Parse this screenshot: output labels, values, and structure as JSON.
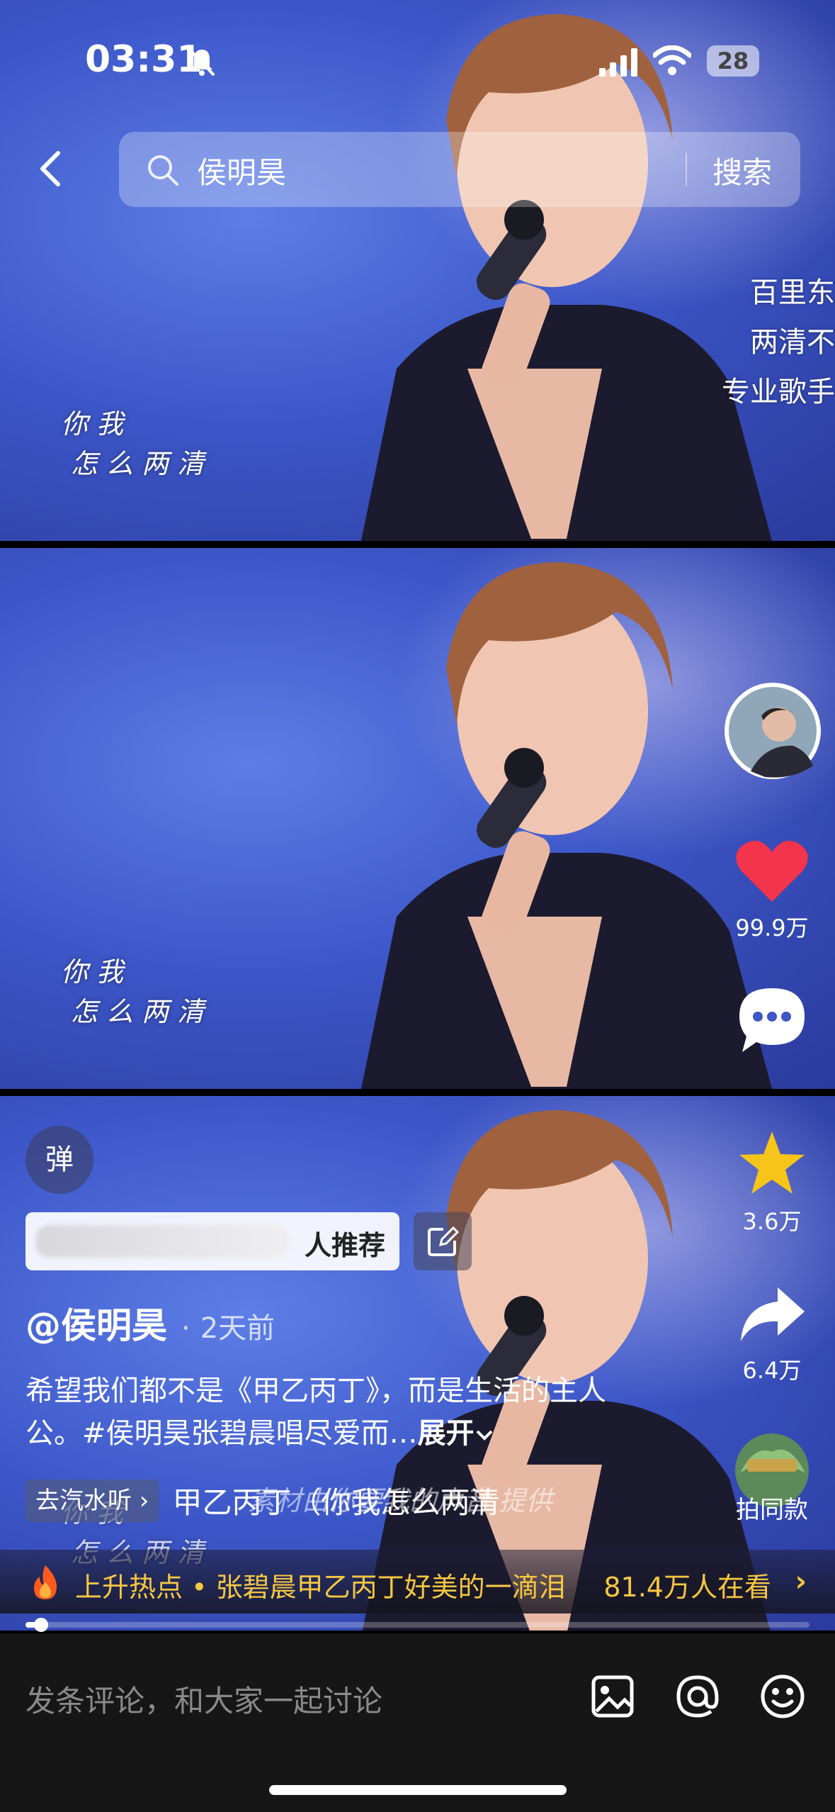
{
  "status_bar": {
    "time": "03:31",
    "battery": "28"
  },
  "search": {
    "query": "侯明昊",
    "button_label": "搜索"
  },
  "overlay_captions": [
    "百里东",
    "两清不",
    "专业歌手"
  ],
  "lyrics": {
    "line1": "你 我",
    "line2": "怎 么 两 清"
  },
  "rail": {
    "likes": "99.9万",
    "favorites": "3.6万",
    "shares": "6.4万",
    "same_style_label": "拍同款"
  },
  "danmu_label": "弹",
  "recommend_label": "人推荐",
  "author": {
    "name": "@侯明昊",
    "time_ago": "2天前"
  },
  "description": {
    "text": "希望我们都不是《甲乙丙丁》，而是生活的主人公。#侯明昊张碧晨唱尽爱而…",
    "expand_label": "展开"
  },
  "music": {
    "tag_label": "去汽水听",
    "title": "甲乙丙丁（你我怎么两清"
  },
  "watermark": "素材由你要我的声音 提供",
  "hot": {
    "text": "上升热点 • 张碧晨甲乙丙丁好美的一滴泪",
    "viewers": "81.4万人在看"
  },
  "progress": {
    "played_fraction": 0.02
  },
  "comment_input": {
    "placeholder": "发条评论，和大家一起讨论"
  },
  "icons": [
    "back-chevron-icon",
    "search-icon",
    "bell-muted-icon",
    "signal-icon",
    "wifi-icon",
    "battery-icon",
    "heart-icon",
    "comment-icon",
    "star-icon",
    "share-icon",
    "edit-icon",
    "fire-icon",
    "chevron-right-icon",
    "image-icon",
    "at-icon",
    "emoji-icon"
  ],
  "colors": {
    "like": "#f2344c",
    "favorite": "#f7c419",
    "hot": "#f7c641"
  }
}
